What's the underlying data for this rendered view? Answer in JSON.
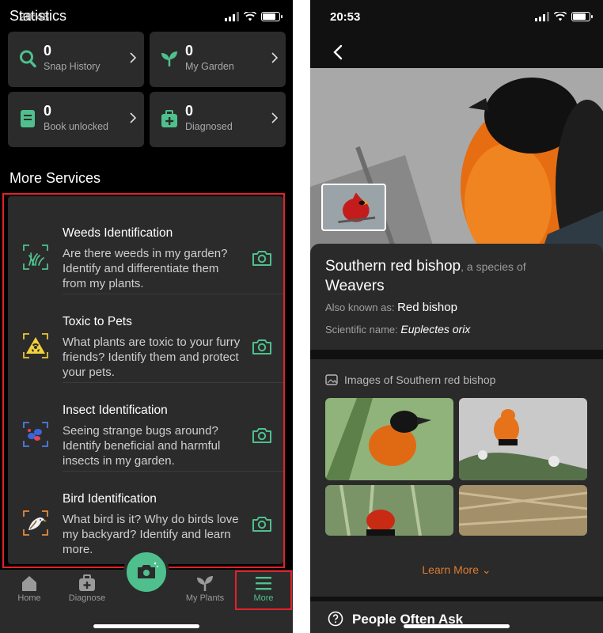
{
  "left": {
    "status_time": "20:48",
    "statistics_title": "Statistics",
    "stats": [
      {
        "count": "0",
        "label": "Snap History",
        "icon": "search-icon"
      },
      {
        "count": "0",
        "label": "My Garden",
        "icon": "sprout-icon"
      },
      {
        "count": "0",
        "label": "Book unlocked",
        "icon": "book-icon"
      },
      {
        "count": "0",
        "label": "Diagnosed",
        "icon": "medical-kit-icon"
      }
    ],
    "more_services_title": "More Services",
    "services": [
      {
        "title": "Weeds Identification",
        "desc": "Are there weeds in my garden? Identify and differentiate them from my plants.",
        "icon": "weeds-icon"
      },
      {
        "title": "Toxic to Pets",
        "desc": "What plants are toxic to your furry friends? Identify them and protect your pets.",
        "icon": "toxic-icon"
      },
      {
        "title": "Insect Identification",
        "desc": "Seeing strange bugs around? Identify beneficial and harmful insects in my garden.",
        "icon": "insect-icon"
      },
      {
        "title": "Bird Identification",
        "desc": "What bird is it? Why do birds love my backyard? Identify and learn more.",
        "icon": "bird-icon"
      }
    ],
    "tabs": {
      "home": "Home",
      "diagnose": "Diagnose",
      "my_plants": "My Plants",
      "more": "More"
    },
    "accent": "#4fc08d",
    "highlight": "#e5202a"
  },
  "right": {
    "status_time": "20:53",
    "common_name": "Southern red bishop",
    "species_of": ", a species of",
    "family": "Weavers",
    "aka_label": "Also known as:",
    "aka_value": "Red bishop",
    "sci_label": "Scientific name:",
    "sci_value": "Euplectes orix",
    "gallery_title": "Images of Southern red bishop",
    "learn_more": "Learn More",
    "people_ask": "People Often Ask",
    "link_color": "#e07b2e"
  }
}
